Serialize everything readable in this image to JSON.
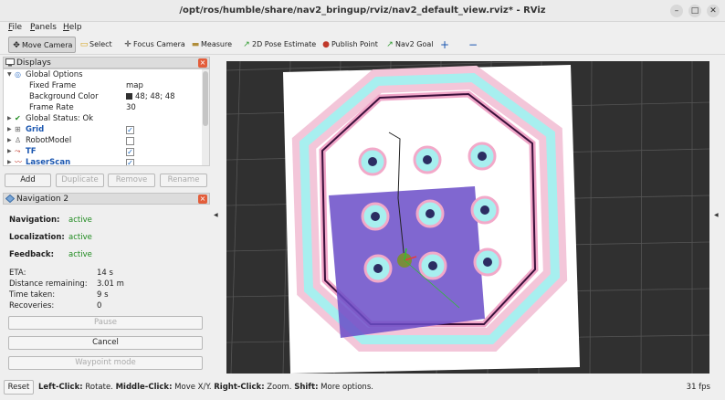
{
  "window": {
    "title": "/opt/ros/humble/share/nav2_bringup/rviz/nav2_default_view.rviz* - RViz",
    "minimize": "–",
    "maximize": "□",
    "close": "✕"
  },
  "menu": [
    {
      "label": "File",
      "mnemonic": "F",
      "rest": "ile"
    },
    {
      "label": "Panels",
      "mnemonic": "P",
      "rest": "anels"
    },
    {
      "label": "Help",
      "mnemonic": "H",
      "rest": "elp"
    }
  ],
  "toolbar": {
    "move_camera": "Move Camera",
    "select": "Select",
    "focus_camera": "Focus Camera",
    "measure": "Measure",
    "pose_estimate": "2D Pose Estimate",
    "publish_point": "Publish Point",
    "nav2_goal": "Nav2 Goal",
    "add_tool": "+",
    "remove_tool": "−"
  },
  "displays": {
    "panel_title": "Displays",
    "close": "×",
    "global_options": "Global Options",
    "fixed_frame_label": "Fixed Frame",
    "fixed_frame_value": "map",
    "bg_color_label": "Background Color",
    "bg_color_value": "48; 48; 48",
    "bg_color_swatch": "#303030",
    "frame_rate_label": "Frame Rate",
    "frame_rate_value": "30",
    "global_status": "Global Status: Ok",
    "items": [
      {
        "label": "Grid",
        "checked": "✓",
        "icon": "grid-icon"
      },
      {
        "label": "RobotModel",
        "checked": "",
        "icon": "robot-icon"
      },
      {
        "label": "TF",
        "checked": "✓",
        "icon": "tf-icon"
      },
      {
        "label": "LaserScan",
        "checked": "✓",
        "icon": "laser-icon"
      }
    ],
    "buttons": {
      "add": "Add",
      "duplicate": "Duplicate",
      "remove": "Remove",
      "rename": "Rename"
    }
  },
  "navigation": {
    "panel_title": "Navigation 2",
    "close": "×",
    "navigation_label": "Navigation:",
    "navigation_value": "active",
    "localization_label": "Localization:",
    "localization_value": "active",
    "feedback_label": "Feedback:",
    "feedback_value": "active",
    "eta_label": "ETA:",
    "eta_value": "14 s",
    "distance_label": "Distance remaining:",
    "distance_value": "3.01 m",
    "time_label": "Time taken:",
    "time_value": "9 s",
    "recoveries_label": "Recoveries:",
    "recoveries_value": "0",
    "pause": "Pause",
    "cancel": "Cancel",
    "waypoint": "Waypoint mode"
  },
  "status": {
    "reset": "Reset",
    "hint_left": "Left-Click:",
    "hint_left_txt": " Rotate. ",
    "hint_middle": "Middle-Click:",
    "hint_middle_txt": " Move X/Y. ",
    "hint_right": "Right-Click:",
    "hint_right_txt": " Zoom. ",
    "hint_shift": "Shift:",
    "hint_shift_txt": " More options.",
    "fps": "31 fps"
  },
  "colors": {
    "accent": "#1a56b0",
    "active": "#1e8a1e",
    "close": "#e35d3a",
    "viewport_bg": "#303030"
  }
}
